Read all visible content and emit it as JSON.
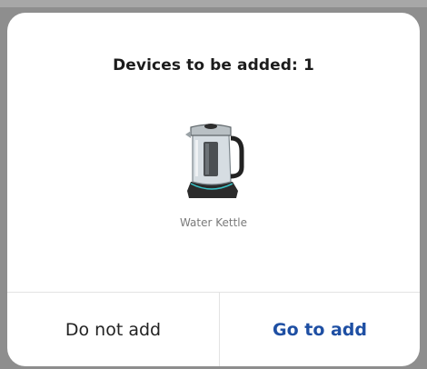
{
  "dialog": {
    "title": "Devices to be added: 1",
    "device": {
      "name": "Water Kettle",
      "image_icon": "water-kettle-image"
    },
    "buttons": {
      "cancel_label": "Do not add",
      "confirm_label": "Go to add"
    }
  },
  "colors": {
    "backdrop": "#8e8e8e",
    "dialog_background": "#ffffff",
    "confirm_text": "#1e4fa3",
    "cancel_text": "#222222",
    "device_name_text": "#7a7a7a"
  }
}
